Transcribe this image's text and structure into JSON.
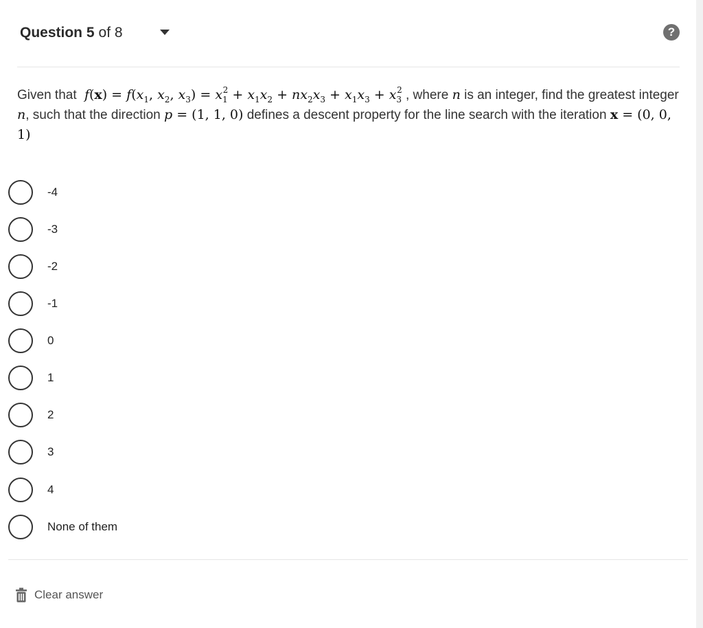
{
  "header": {
    "question_label": "Question 5",
    "of_label": "of 8",
    "help_icon": "question-mark-circle-icon",
    "dropdown_icon": "caret-down-icon"
  },
  "question": {
    "intro": "Given that",
    "f_of_x": "f(x) = f(x1, x2, x3) = x1^2 + x1x2 + n x2x3 + x1x3 + x3^2",
    "where": ", where",
    "n": "n",
    "is_integer": "is an integer, find the greatest integer",
    "such_that": ", such that the direction",
    "p_expr": "p = (1, 1, 0)",
    "defines": "defines a descent property for the line search with the iteration",
    "x_expr": "x = (0, 0, 1)"
  },
  "options": [
    "-4",
    "-3",
    "-2",
    "-1",
    "0",
    "1",
    "2",
    "3",
    "4",
    "None of them"
  ],
  "footer": {
    "clear_label": "Clear answer",
    "clear_icon": "trash-icon"
  },
  "colors": {
    "text": "#333333",
    "help_bg": "#707070",
    "divider": "#e6e6e6"
  }
}
